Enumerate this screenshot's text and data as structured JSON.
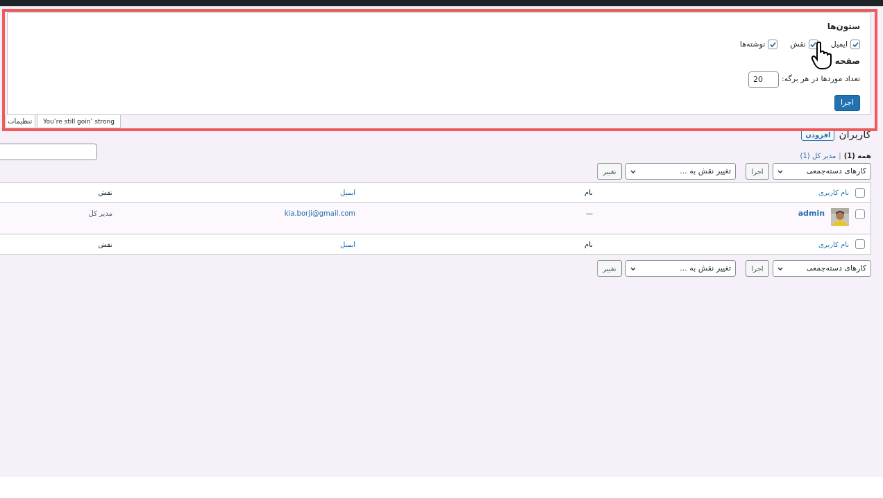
{
  "screen_options": {
    "columns_heading": "ستون‌ها",
    "columns": [
      {
        "label": "ایمیل",
        "checked": true
      },
      {
        "label": "نقش",
        "checked": true
      },
      {
        "label": "نوشته‌ها",
        "checked": true
      }
    ],
    "pagination_heading": "صفحه",
    "per_page_label": "تعداد موردها در هر برگه:",
    "per_page_value": "20",
    "apply_button": "اجرا"
  },
  "screen_options_tab": "تنظیمات",
  "dolly_text": "You’re still goin’ strong",
  "page_title": "کاربران",
  "add_button": "افزودن",
  "filter_separator": "|",
  "filters": [
    {
      "label": "همه",
      "count": "(1)",
      "selected": true
    },
    {
      "label": "مدیر کل",
      "count": "(1)",
      "selected": false
    }
  ],
  "bulk_bars": [
    {
      "bulk_action": "کارهای دسته‌جمعی",
      "apply": "اجرا",
      "change_role": "تغییر نقش به ...",
      "change": "تغییر"
    },
    {
      "bulk_action": "کارهای دسته‌جمعی",
      "apply": "اجرا",
      "change_role": "تغییر نقش به ...",
      "change": "تغییر"
    }
  ],
  "table": {
    "columns": [
      "نام کاربری",
      "نام",
      "ایمیل",
      "نقش"
    ],
    "header_checked": false,
    "rows": [
      {
        "username": "admin",
        "name": "—",
        "email": "kia.borji@gmail.com",
        "role": "مدیر کل",
        "checked": false
      }
    ],
    "footer_columns": [
      "نام کاربری",
      "نام",
      "ایمیل",
      "نقش"
    ],
    "footer_checked": false
  }
}
